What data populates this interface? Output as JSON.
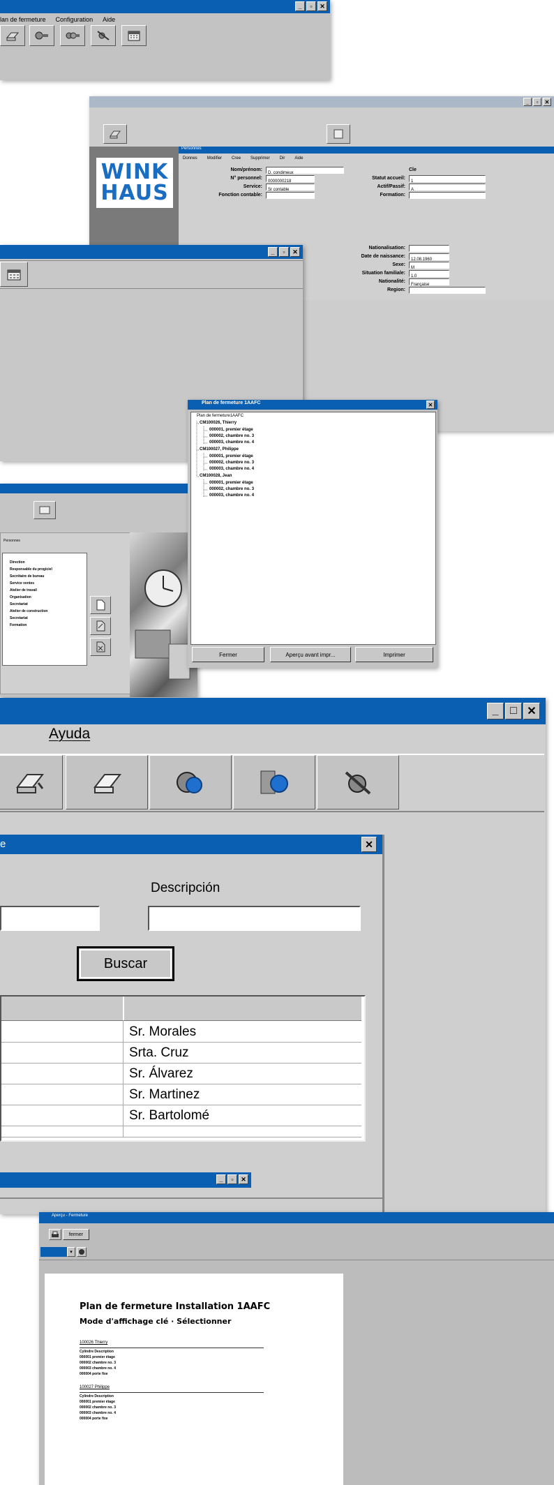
{
  "win1": {
    "menu": [
      "lan de fermeture",
      "Configuration",
      "Aide"
    ],
    "tool_icons": [
      "printer-icon",
      "key-icon",
      "keys-icon",
      "disabled-key-icon",
      "calendar-icon"
    ]
  },
  "win2": {
    "logo_line1": "WINK",
    "logo_line2": "HAUS",
    "inner_title": "Personnes",
    "menu": [
      "Donnes",
      "Modifier",
      "Cree",
      "Supprimer",
      "Dir",
      "Aide"
    ],
    "fields_left": [
      {
        "label": "Nom/prénom:",
        "value": "D. condimeux"
      },
      {
        "label": "N° personnel:",
        "value": "0000000218"
      },
      {
        "label": "Service:",
        "value": "Sr contable"
      },
      {
        "label": "Fonction contable:",
        "value": ""
      }
    ],
    "fields_right": [
      {
        "label": "Statut accueil:",
        "value": "1"
      },
      {
        "label": "Actif/Passif:",
        "value": "A"
      },
      {
        "label": "Formation:",
        "value": ""
      }
    ],
    "title_right_label": "Cle",
    "fields_lower": [
      {
        "label": "Nationalisation:",
        "value": ""
      },
      {
        "label": "Date de naissance:",
        "value": "12.08.1960"
      },
      {
        "label": "Sexe:",
        "value": "M"
      },
      {
        "label": "Situation familiale:",
        "value": "1.0"
      },
      {
        "label": "Nationalité:",
        "value": "Française"
      },
      {
        "label": "Region:",
        "value": ""
      }
    ]
  },
  "tree": {
    "title": "Plan de fermeture 1AAFC",
    "root": "Plan de fermeture1AAFC",
    "groups": [
      {
        "name": "CM100026, Thierry",
        "items": [
          "000001, premier étage",
          "000002, chambre no. 3",
          "000003, chambre no. 4"
        ]
      },
      {
        "name": "CM100027, Philippe",
        "items": [
          "000001, premier étage",
          "000002, chambre no. 3",
          "000003, chambre no. 4"
        ]
      },
      {
        "name": "CM100028, Jean",
        "items": [
          "000001, premier étage",
          "000002, chambre no. 3",
          "000003, chambre no. 4"
        ]
      }
    ],
    "buttons": [
      "Fermer",
      "Aperçu avant impr...",
      "Imprimer"
    ]
  },
  "win5": {
    "list_header": "Personnes",
    "list_items": [
      "Direction",
      "Responsable du progiciel",
      "Secrétaire de bureau",
      "Service ventes",
      "Atelier de travail",
      "Organisation",
      "Secretariat",
      "Atelier de construction",
      "Secretariat",
      "Formation"
    ]
  },
  "main": {
    "menu_ayuda": "Ayuda",
    "dialog_title": "e",
    "descripcion_label": "Descripción",
    "descripcion_value": "",
    "buscar": "Buscar",
    "rows": [
      "Sr. Morales",
      "Srta. Cruz",
      "Sr. Álvarez",
      "Sr. Martinez",
      "Sr. Bartolomé",
      ""
    ]
  },
  "preview": {
    "title": "Aperçu - Fermeture",
    "close_button": "fermer",
    "doc_title": "Plan de fermeture Installation 1AAFC",
    "doc_subtitle": "Mode d'affichage clé · Sélectionner",
    "groups": [
      {
        "header": "100026   Thierry",
        "rows": [
          "Cylindre   Description",
          "000001   premier étage",
          "000002   chambre no. 3",
          "000003   chambre no. 4",
          "000004   porte fixe"
        ]
      },
      {
        "header": "100027   Philippe",
        "rows": [
          "Cylindre   Description",
          "000001   premier étage",
          "000002   chambre no. 3",
          "000003   chambre no. 4",
          "000004   porte fixe"
        ]
      }
    ]
  }
}
